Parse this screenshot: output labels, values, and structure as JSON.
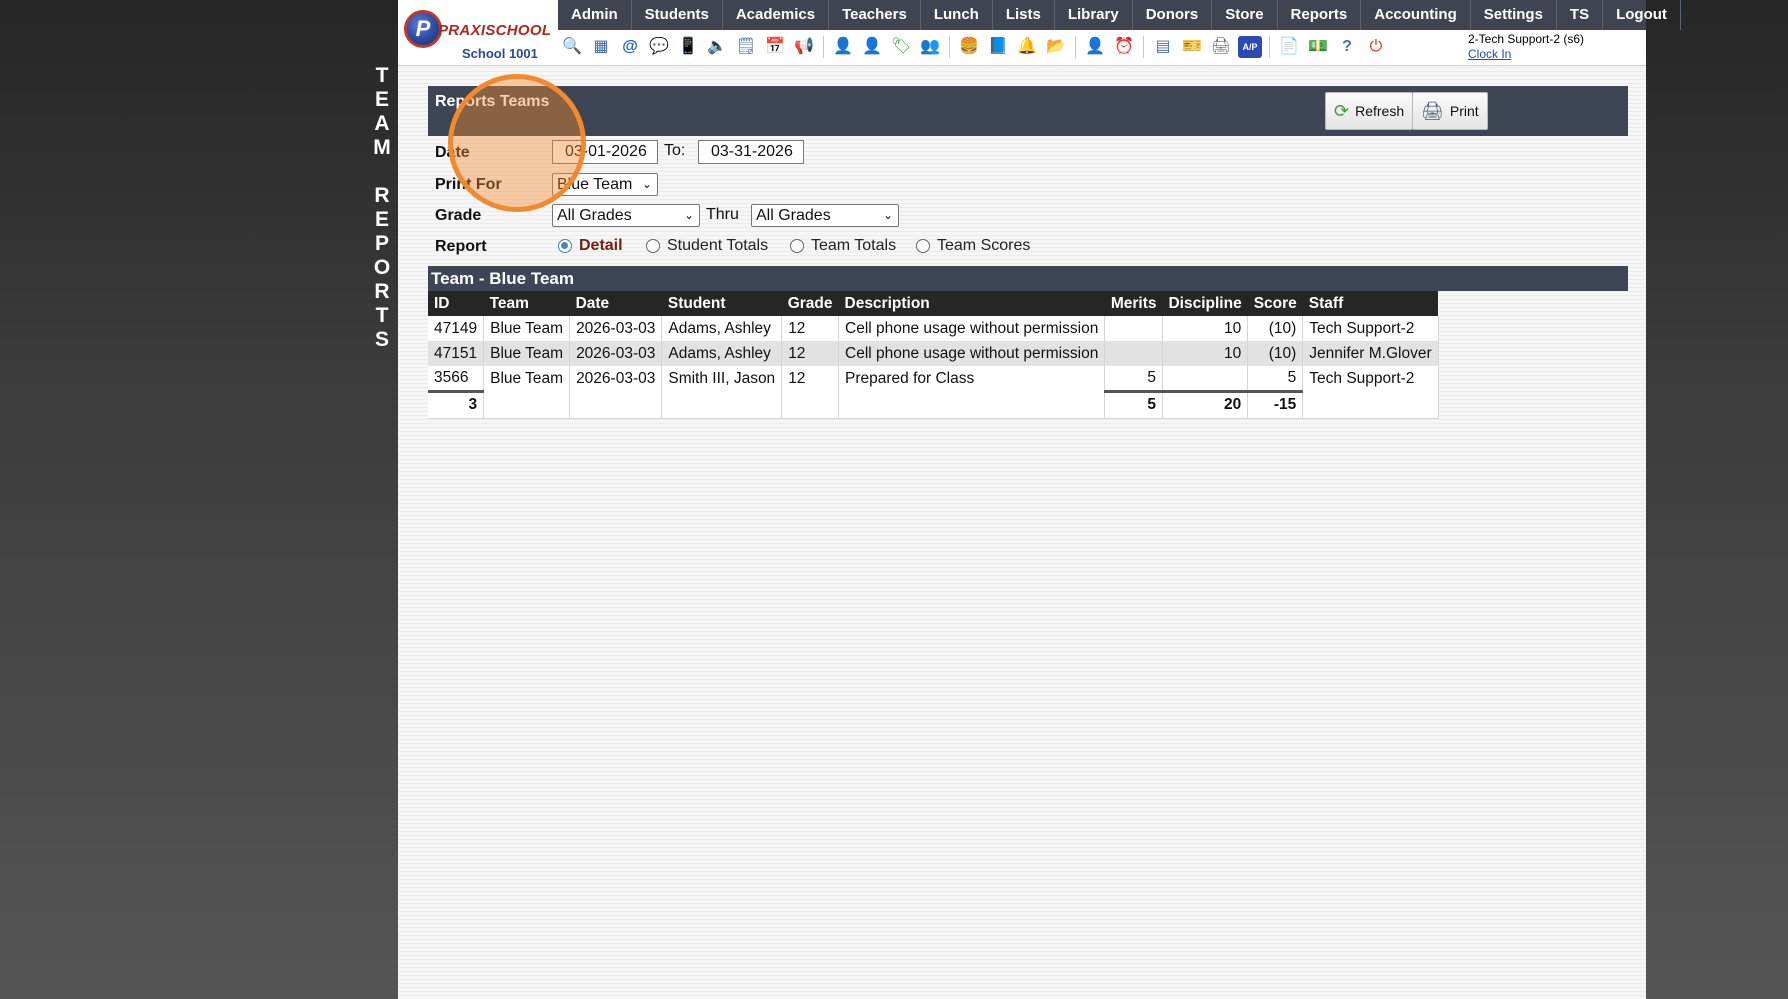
{
  "side_label": [
    "T",
    "E",
    "A",
    "M",
    "",
    "R",
    "E",
    "P",
    "O",
    "R",
    "T",
    "S"
  ],
  "logo": {
    "letter": "P",
    "brand": "PRAXISCHOOL",
    "school": "School 1001"
  },
  "nav": [
    "Admin",
    "Students",
    "Academics",
    "Teachers",
    "Lunch",
    "Lists",
    "Library",
    "Donors",
    "Store",
    "Reports",
    "Accounting",
    "Settings",
    "TS",
    "Logout"
  ],
  "toolbar_icons": [
    {
      "name": "search-icon",
      "glyph": "🔍"
    },
    {
      "name": "calendar-grid-icon",
      "glyph": "▦"
    },
    {
      "name": "email-icon",
      "glyph": "@"
    },
    {
      "name": "chat-icon",
      "glyph": "💬"
    },
    {
      "name": "phone-icon",
      "glyph": "📱"
    },
    {
      "name": "speaker-icon",
      "glyph": "🔈"
    },
    {
      "name": "notes-icon",
      "glyph": "🗒"
    },
    {
      "name": "calendar-icon",
      "glyph": "📅"
    },
    {
      "name": "megaphone-icon",
      "glyph": "📢"
    },
    {
      "name": "sep"
    },
    {
      "name": "student-icon",
      "glyph": "👤"
    },
    {
      "name": "teacher-icon",
      "glyph": "👤"
    },
    {
      "name": "tag-icon",
      "glyph": "🏷"
    },
    {
      "name": "group-icon",
      "glyph": "👥"
    },
    {
      "name": "sep"
    },
    {
      "name": "lunch-icon",
      "glyph": "🍔"
    },
    {
      "name": "book-icon",
      "glyph": "📘"
    },
    {
      "name": "bell-icon",
      "glyph": "🔔"
    },
    {
      "name": "folder-arrow-icon",
      "glyph": "📂"
    },
    {
      "name": "sep"
    },
    {
      "name": "staff-icon",
      "glyph": "👤"
    },
    {
      "name": "clock-icon",
      "glyph": "⏰"
    },
    {
      "name": "sep"
    },
    {
      "name": "table-icon",
      "glyph": "▤"
    },
    {
      "name": "ticket-icon",
      "glyph": "🎫"
    },
    {
      "name": "printer-card-icon",
      "glyph": "🖨"
    },
    {
      "name": "ap-icon",
      "glyph": "A/P"
    },
    {
      "name": "sep"
    },
    {
      "name": "pdf-icon",
      "glyph": "📄"
    },
    {
      "name": "money-icon",
      "glyph": "💵"
    },
    {
      "name": "help-icon",
      "glyph": "?"
    },
    {
      "name": "power-icon",
      "glyph": "⏻"
    }
  ],
  "user": {
    "name": "2-Tech Support-2 (s6)",
    "clock_in": "Clock In"
  },
  "panel": {
    "title": "Reports Teams",
    "refresh": "Refresh",
    "print": "Print"
  },
  "form": {
    "date_label": "Date",
    "date_from": "03-01-2026",
    "to_label": "To:",
    "date_to": "03-31-2026",
    "print_for_label": "Print For",
    "print_for_value": "Blue Team",
    "grade_label": "Grade",
    "grade_from": "All Grades",
    "thru_label": "Thru",
    "grade_to": "All Grades",
    "report_label": "Report",
    "report_options": [
      "Detail",
      "Student Totals",
      "Team Totals",
      "Team Scores"
    ],
    "report_selected": "Detail"
  },
  "team_header": "Team - Blue Team",
  "table": {
    "columns": [
      "ID",
      "Team",
      "Date",
      "Student",
      "Grade",
      "Description",
      "Merits",
      "Discipline",
      "Score",
      "Staff"
    ],
    "rows": [
      {
        "id": "47149",
        "team": "Blue Team",
        "date": "2026-03-03",
        "student": "Adams, Ashley",
        "grade": "12",
        "description": "Cell phone usage without permission",
        "merits": "",
        "discipline": "10",
        "score": "(10)",
        "staff": "Tech Support-2"
      },
      {
        "id": "47151",
        "team": "Blue Team",
        "date": "2026-03-03",
        "student": "Adams, Ashley",
        "grade": "12",
        "description": "Cell phone usage without permission",
        "merits": "",
        "discipline": "10",
        "score": "(10)",
        "staff": "Jennifer M.Glover"
      },
      {
        "id": "3566",
        "team": "Blue Team",
        "date": "2026-03-03",
        "student": "Smith III, Jason",
        "grade": "12",
        "description": "Prepared for Class",
        "merits": "5",
        "discipline": "",
        "score": "5",
        "staff": "Tech Support-2"
      }
    ],
    "totals": {
      "count": "3",
      "merits": "5",
      "discipline": "20",
      "score": "-15"
    }
  },
  "colors": {
    "nav_bg": "#3f4450",
    "panel_bg": "#3e4554",
    "highlight": "#f18a2f",
    "selected_radio_label": "#7a1d0f"
  }
}
